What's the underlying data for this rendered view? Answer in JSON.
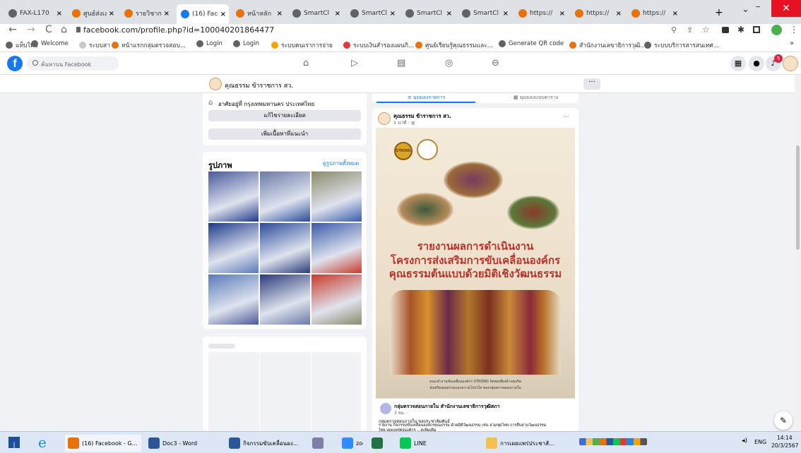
{
  "tabs": [
    {
      "label": "FAX-L170",
      "fav": "#5f6368"
    },
    {
      "label": "ศูนย์ส่งเสริ",
      "fav": "#e8710a"
    },
    {
      "label": "รายวิชาการ",
      "fav": "#e8710a"
    },
    {
      "label": "(16) Face",
      "fav": "#1877f2"
    },
    {
      "label": "หน้าหลัก",
      "fav": "#e8710a"
    },
    {
      "label": "SmartCl",
      "fav": "#5f6368"
    },
    {
      "label": "SmartCl",
      "fav": "#5f6368"
    },
    {
      "label": "SmartCl",
      "fav": "#5f6368"
    },
    {
      "label": "SmartCl",
      "fav": "#5f6368"
    },
    {
      "label": "https://",
      "fav": "#e8710a"
    },
    {
      "label": "https://",
      "fav": "#e8710a"
    },
    {
      "label": "https://",
      "fav": "#e8710a"
    }
  ],
  "new_tab": "+",
  "window": {
    "chevron": "⌄",
    "minimize": "–",
    "restore": "❐",
    "close": "✕"
  },
  "nav": {
    "back": "←",
    "forward": "→",
    "reload": "C",
    "home": "⌂",
    "url": "facebook.com/profile.php?id=100040201864477"
  },
  "bookmarks": [
    {
      "label": "แท็บใหม่",
      "c": "#5f6368"
    },
    {
      "label": "Welcome",
      "c": "#5f6368"
    },
    {
      "label": "ระบบสา",
      "c": "#c9c9c9"
    },
    {
      "label": "หน้าแรกกลุ่มตรวจสอบ...",
      "c": "#e8710a"
    },
    {
      "label": "Login",
      "c": "#5f6368"
    },
    {
      "label": "Login",
      "c": "#5f6368"
    },
    {
      "label": "ระบบคนเราการจ่าย",
      "c": "#f4a300"
    },
    {
      "label": "ระบบเงินสำรองแผนกิ...",
      "c": "#e53935"
    },
    {
      "label": "ศูนย์เรียนรู้คุณธรรมและ...",
      "c": "#e8710a"
    },
    {
      "label": "Generate QR code",
      "c": "#5f6368"
    },
    {
      "label": "สำนักงานเลขาธิการวุฒิ...",
      "c": "#e8710a"
    },
    {
      "label": "ระบบบริการสารสนเทศ...",
      "c": "#5f6368"
    }
  ],
  "bookmarks_more": "»",
  "fb": {
    "logo": "f",
    "search_placeholder": "ค้นหาบน Facebook",
    "badge": "5"
  },
  "profile": {
    "name": "คุณธรรม ข้าราชการ สว.",
    "more": "···"
  },
  "intro": {
    "location": "อาศัยอยู่ที่ กรุงเทพมหานคร ประเทศไทย",
    "edit_details": "แก้ไขรายละเอียด",
    "add_featured": "เพิ่มเนื้อหาที่แนะนำ"
  },
  "photos": {
    "title": "รูปภาพ",
    "see_all": "ดูรูปภาพทั้งหมด"
  },
  "feed_tabs": {
    "list": "มุมมองรายการ",
    "grid": "มุมมองแบบตาราง"
  },
  "post": {
    "author": "คุณธรรม ข้าราชการ สว.",
    "time": "1 นาที · ",
    "more": "···",
    "title1": "รายงานผลการดำเนินงาน",
    "title2": "โครงการส่งเสริมการขับเคลื่อนองค์กร",
    "title3": "คุณธรรมต้นแบบด้วยมิติเชิงวัฒนธรรม",
    "caption1": "คณะทำงานขับเคลื่อนองค์กร STRONG จิตพอเพียงต้านทุจริต",
    "caption2": "ส่งเสริมคุณธรรมและความโปร่งใส ของกลุ่มตรวจสอบภายใน",
    "strong_logo": "STRONG",
    "shared_author": "กลุ่มตรวจสอบภายใน สำนักงานเลขาธิการวุฒิสภา",
    "shared_time": "3 ชม. · ",
    "shared_text1": "กลุ่มตรวจสอบภายใน ขอประชาสัมพันธ์",
    "shared_text2": "รายงาน กิจกรรมขับเคลื่อนองค์กรคุณธรรม ด้วยมิติวัฒนธรรม เช่น สวมชุดไทย การสืบสานวัฒนธรรม",
    "shared_text3": "ไทย เผยแพร่ต่อองค์กร ...ดูเพิ่มเติม"
  },
  "taskbar": [
    {
      "label": "(16) Facebook - G...",
      "c": "#e8710a"
    },
    {
      "label": "Doc3 - Word",
      "c": "#2b579a"
    },
    {
      "label": "กิจกรรมขับเคลื่อนอง...",
      "c": "#2b579a"
    },
    {
      "label": "",
      "c": "#7f7fa8"
    },
    {
      "label": "zoom",
      "c": "#2d8cff"
    },
    {
      "label": "",
      "c": "#217346"
    },
    {
      "label": "LINE",
      "c": "#06c755"
    },
    {
      "label": "การเผยแพร่ประชาสั...",
      "c": "#f2c14e"
    }
  ],
  "tray": {
    "lang": "ENG",
    "time": "14:14",
    "date": "20/3/2567"
  },
  "icons": [
    "globe-icon",
    "fb-home-icon",
    "fb-video-icon",
    "fb-marketplace-icon",
    "fb-groups-icon",
    "fb-gaming-icon",
    "grid-menu-icon",
    "messenger-icon",
    "bell-icon",
    "edit-icon"
  ]
}
